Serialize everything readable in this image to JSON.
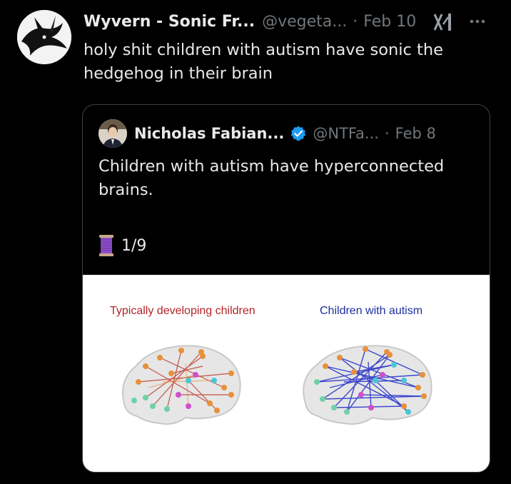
{
  "tweet": {
    "display_name": "Wyvern - Sonic Fr...",
    "handle": "@vegeta...",
    "separator": "·",
    "date": "Feb 10",
    "text": "holy shit children with autism have sonic the hedgehog in their brain",
    "avatar_icon": "dragon-avatar",
    "more_icon": "more-dots-icon",
    "grok_icon": "grok-icon"
  },
  "quote": {
    "display_name": "Nicholas Fabian...",
    "handle": "@NTFa...",
    "separator": "·",
    "date": "Feb 8",
    "verified_color": "#1d9bf0",
    "text": "Children with autism have hyperconnected brains.",
    "thread_icon": "spool-of-thread",
    "thread_counter": "1/9",
    "media": {
      "left_label": "Typically developing children",
      "right_label": "Children with autism",
      "left_color": "#b3242a",
      "right_color": "#1f2f9c"
    }
  }
}
